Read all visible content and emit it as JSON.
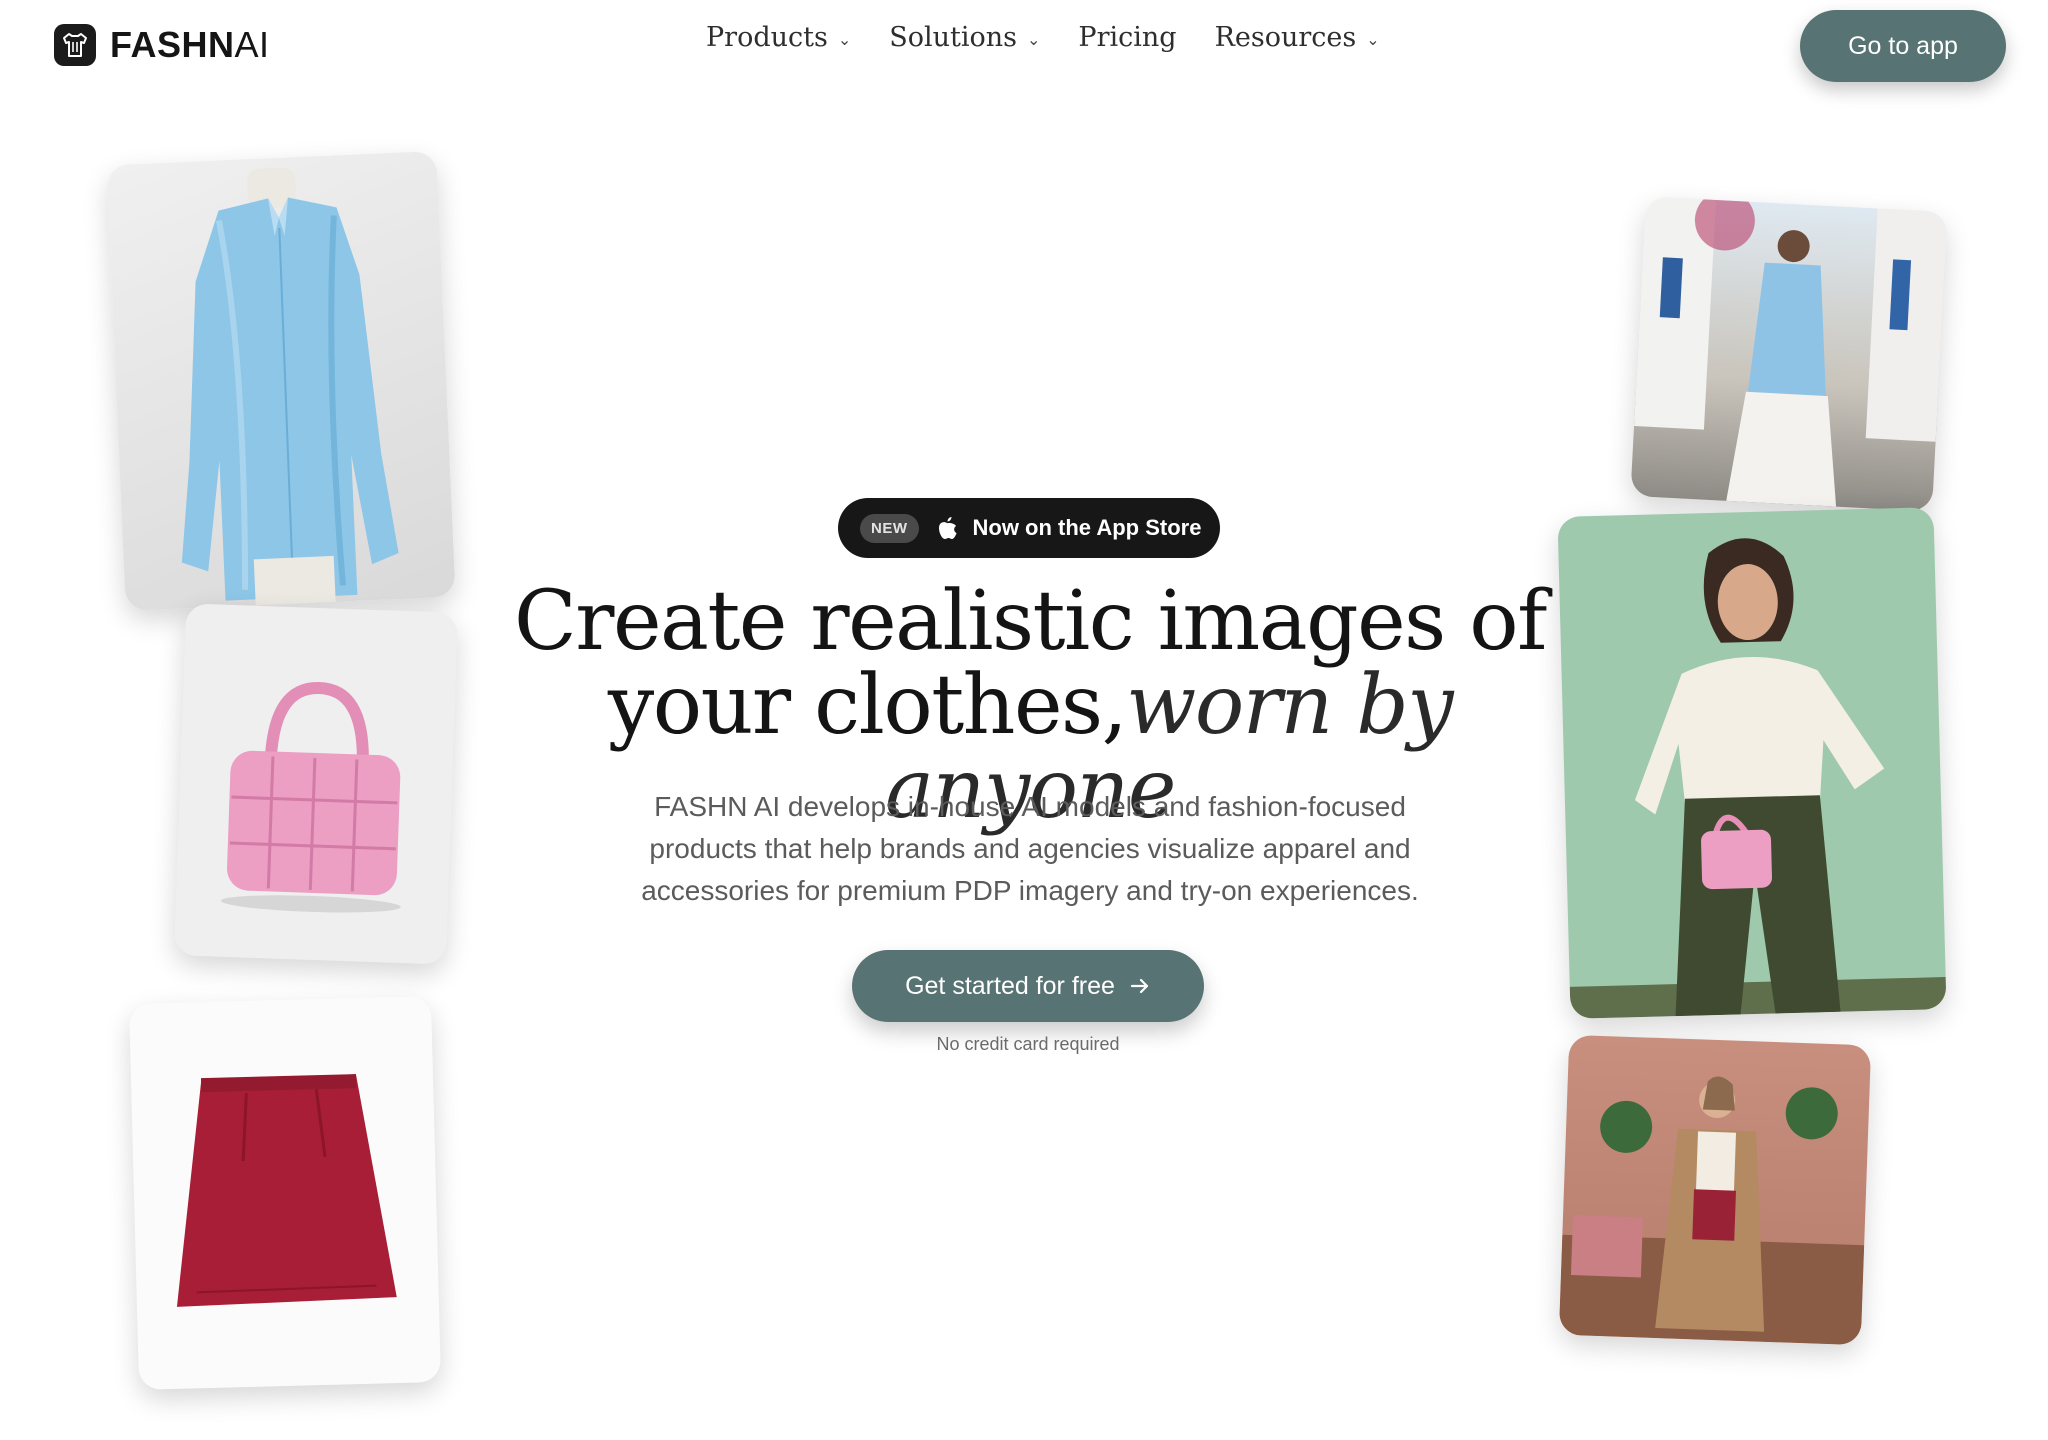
{
  "brand": {
    "name_bold": "FASHN",
    "name_light": "AI"
  },
  "nav": {
    "items": [
      {
        "label": "Products",
        "has_dropdown": true
      },
      {
        "label": "Solutions",
        "has_dropdown": true
      },
      {
        "label": "Pricing",
        "has_dropdown": false
      },
      {
        "label": "Resources",
        "has_dropdown": true
      }
    ],
    "dropdown_icon": "chevron-down-icon"
  },
  "header": {
    "cta_label": "Go to app"
  },
  "hero": {
    "badge": {
      "tag": "NEW",
      "icon": "apple-icon",
      "text": "Now on the App Store"
    },
    "headline_line1": "Create realistic images of",
    "headline_line2_plain": "your clothes,",
    "headline_line2_italic": "worn by anyone",
    "subtitle": "FASHN AI develops in-house AI models and fashion-focused products that help brands and agencies visualize apparel and accessories for premium PDP imagery and try-on experiences.",
    "cta_label": "Get started for free",
    "cta_icon": "arrow-right-icon",
    "note": "No credit card required"
  },
  "colors": {
    "accent": "#587373",
    "badge_bg": "#171717",
    "text": "#141414",
    "muted": "#5b5b5b"
  }
}
